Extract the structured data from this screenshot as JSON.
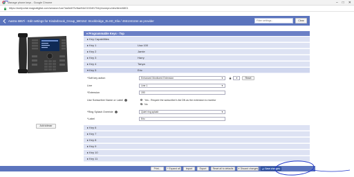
{
  "window": {
    "title": "Manage phone keys - Google Chrome",
    "controls": [
      "–",
      "□",
      "✕"
    ]
  },
  "browser": {
    "url": "https://axelportal.magnaligital.com/session/1ae7da3d4f7b/8ae94e01534f1754/phonepro/des/item/6801"
  },
  "header": {
    "title": "Aastra 6867i - Edit settings for Kindarbrook_Group_580152: Stockbridge_ELSD_Elia / 4551341154 as provider",
    "filter_placeholder": "Filter settings...",
    "clear_label": "Clear"
  },
  "left": {
    "add_sidecar_label": "Add sidecar"
  },
  "panel": {
    "title": "▾ Programmable Keys - Top",
    "capabilities_label": "▸ Key Capabilities",
    "keys_top": [
      {
        "label": "▸ Key 1",
        "value": "Lisa 100"
      },
      {
        "label": "▸ Key 2",
        "value": "Jamie"
      },
      {
        "label": "▸ Key 3",
        "value": "Harry"
      },
      {
        "label": "▸ Key 4",
        "value": "Tanya"
      },
      {
        "label": "▾ Key 5",
        "value": "Eric"
      }
    ],
    "key5": {
      "soft_key_action_label": "*Soft key action",
      "soft_key_action_value": "Enhanced Monitored Extension",
      "reset_label": "Reset",
      "line_label": "Line",
      "line_value": "Line 1",
      "extension_label": "*Extension",
      "extension_value": "190",
      "use_subscriber_label": "Use Subscriber Name or Label",
      "radio_yes_label": "Yes - Require the subscriber's list DN as the extension to monitor",
      "radio_no_label": "No",
      "ring_splash_label": "*Ring Splash Override",
      "ring_splash_value": "Quiet ring splash",
      "label_label": "*Label",
      "label_value": "Eric"
    },
    "keys_bottom": [
      {
        "label": "▸ Key 6",
        "value": ""
      },
      {
        "label": "▸ Key 7",
        "value": ""
      },
      {
        "label": "▸ Key 8",
        "value": ""
      },
      {
        "label": "▸ Key 9",
        "value": ""
      },
      {
        "label": "▸ Key 10",
        "value": ""
      },
      {
        "label": "▸ Key 11",
        "value": ""
      }
    ]
  },
  "toolbar": {
    "print": "Print...",
    "expand_all": "+ Expand all",
    "import": "Import",
    "export": "Export",
    "reset_defaults": "Reset all to defaults",
    "discard": "✕ Discard changes",
    "save": "Save changes"
  },
  "colors": {
    "header_blue": "#5b74bd",
    "row_blue": "#dde2f3",
    "annotation_blue": "#1f35c8"
  },
  "icons": [
    "chrome-icon",
    "lock-icon",
    "back-arrow-icon",
    "info-icon",
    "phone-image",
    "save-check-icon"
  ]
}
